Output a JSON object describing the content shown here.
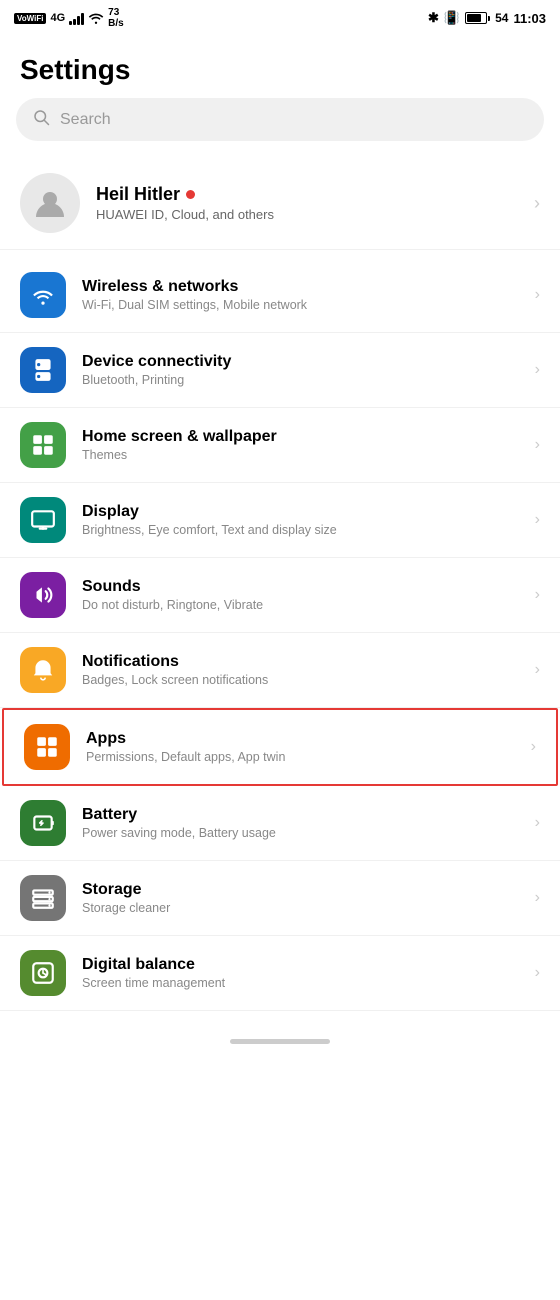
{
  "statusBar": {
    "left": {
      "vowifi": "VoWiFi",
      "network": "4G",
      "speed": "73\nB/s"
    },
    "right": {
      "bluetooth": "✱",
      "battery": "54",
      "time": "11:03"
    }
  },
  "page": {
    "title": "Settings"
  },
  "search": {
    "placeholder": "Search"
  },
  "profile": {
    "name": "Heil Hitler",
    "subtitle": "HUAWEI ID, Cloud, and others",
    "hasNotification": true
  },
  "settingsItems": [
    {
      "id": "wireless",
      "title": "Wireless & networks",
      "subtitle": "Wi-Fi, Dual SIM settings, Mobile network",
      "iconColor": "icon-blue",
      "iconType": "wifi"
    },
    {
      "id": "device-connectivity",
      "title": "Device connectivity",
      "subtitle": "Bluetooth, Printing",
      "iconColor": "icon-blue2",
      "iconType": "bluetooth"
    },
    {
      "id": "home-screen",
      "title": "Home screen & wallpaper",
      "subtitle": "Themes",
      "iconColor": "icon-green",
      "iconType": "home"
    },
    {
      "id": "display",
      "title": "Display",
      "subtitle": "Brightness, Eye comfort, Text and display size",
      "iconColor": "icon-teal",
      "iconType": "display"
    },
    {
      "id": "sounds",
      "title": "Sounds",
      "subtitle": "Do not disturb, Ringtone, Vibrate",
      "iconColor": "icon-purple",
      "iconType": "sound"
    },
    {
      "id": "notifications",
      "title": "Notifications",
      "subtitle": "Badges, Lock screen notifications",
      "iconColor": "icon-yellow",
      "iconType": "notification"
    },
    {
      "id": "apps",
      "title": "Apps",
      "subtitle": "Permissions, Default apps, App twin",
      "iconColor": "icon-orange",
      "iconType": "apps",
      "highlighted": true
    },
    {
      "id": "battery",
      "title": "Battery",
      "subtitle": "Power saving mode, Battery usage",
      "iconColor": "icon-green2",
      "iconType": "battery"
    },
    {
      "id": "storage",
      "title": "Storage",
      "subtitle": "Storage cleaner",
      "iconColor": "icon-gray",
      "iconType": "storage"
    },
    {
      "id": "digital-balance",
      "title": "Digital balance",
      "subtitle": "Screen time management",
      "iconColor": "icon-green3",
      "iconType": "balance"
    }
  ]
}
